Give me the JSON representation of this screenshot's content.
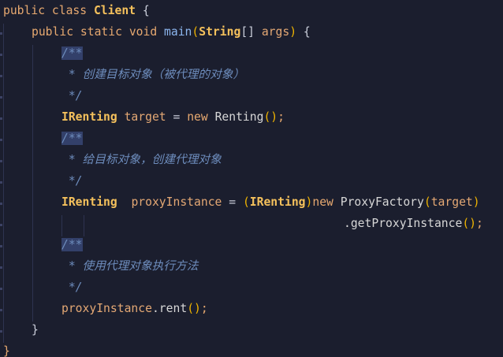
{
  "code": {
    "line1": {
      "kw1": "public",
      "kw2": "class",
      "cls": "Client",
      "brace": "{"
    },
    "line2": {
      "kw1": "public",
      "kw2": "static",
      "kw3": "void",
      "fn": "main",
      "paren_open": "(",
      "type": "String",
      "arr": "[]",
      "arg": "args",
      "paren_close": ")",
      "brace": "{"
    },
    "line3": {
      "doc_open": "/**"
    },
    "line4": {
      "comment": " * 创建目标对象（被代理的对象）"
    },
    "line5": {
      "doc_close": " */"
    },
    "line6": {
      "type": "IRenting",
      "var": "target",
      "assign": "=",
      "kw": "new",
      "cls": "Renting",
      "call": "()",
      "semi": ";"
    },
    "line7": {
      "doc_open": "/**"
    },
    "line8": {
      "comment": " * 给目标对象，创建代理对象"
    },
    "line9": {
      "doc_close": " */"
    },
    "line10": {
      "type": "IRenting",
      "var": "proxyInstance",
      "assign": "=",
      "paren_open": "(",
      "cast_type": "IRenting",
      "paren_close": ")",
      "kw": "new",
      "cls": "ProxyFactory",
      "arg_open": "(",
      "arg": "target",
      "arg_close": ")"
    },
    "line11": {
      "dot_method": ".getProxyInstance",
      "call": "()",
      "semi": ";"
    },
    "line12": {
      "doc_open": "/**"
    },
    "line13": {
      "comment": " * 使用代理对象执行方法"
    },
    "line14": {
      "doc_close": " */"
    },
    "line15": {
      "var": "proxyInstance",
      "method": ".rent",
      "call": "()",
      "semi": ";"
    },
    "line16": {
      "brace": "}"
    },
    "line17": {
      "brace": "}"
    }
  },
  "colors": {
    "background": "#1b1e2e",
    "keyword": "#e7a970",
    "class_bold": "#f5c15c",
    "function": "#8db7ef",
    "variable": "#e4a874",
    "comment": "#6d8cbc",
    "doc_highlight": "#33406a"
  }
}
